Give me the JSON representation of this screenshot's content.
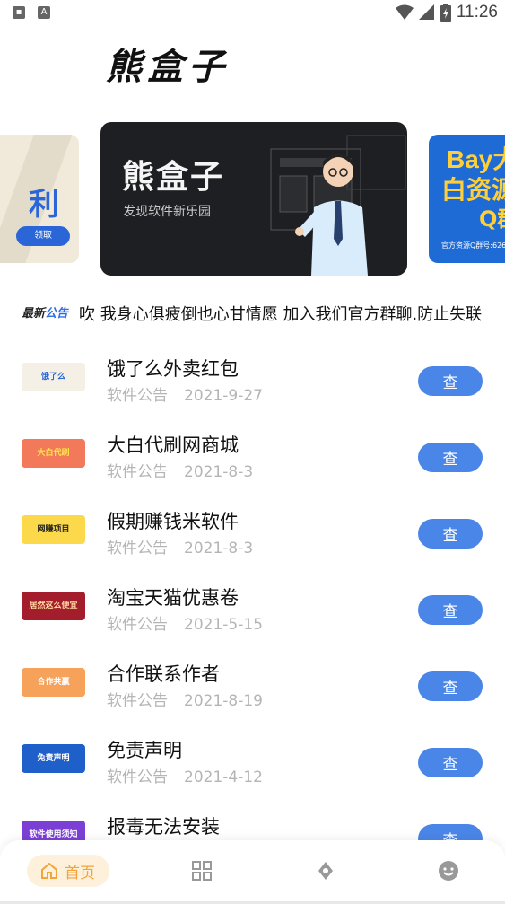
{
  "status_bar": {
    "time": "11:26"
  },
  "app": {
    "logo_text": "熊盒子"
  },
  "banners": [
    {
      "text": "利",
      "pill": "领取"
    },
    {
      "title": "熊盒子",
      "subtitle": "发现软件新乐园"
    },
    {
      "line1": "Bay大",
      "line2": "白资源",
      "line3": "Q群",
      "footer": "官方资源Q群号:626"
    }
  ],
  "announcement": {
    "tag_part1": "最新",
    "tag_part2": "公告",
    "text": "吹 我身心俱疲倒也心甘情愿 加入我们官方群聊.防止失联"
  },
  "list": {
    "action_label": "查",
    "category": "软件公告",
    "items": [
      {
        "title": "饿了么外卖红包",
        "date": "2021-9-27",
        "thumb_text": "饿了么",
        "thumb_bg": "#f4f0e6",
        "thumb_fg": "#2a66d8"
      },
      {
        "title": "大白代刷网商城",
        "date": "2021-8-3",
        "thumb_text": "大白代刷",
        "thumb_bg": "#f27a5b",
        "thumb_fg": "#ffe34d"
      },
      {
        "title": "假期赚钱米软件",
        "date": "2021-8-3",
        "thumb_text": "网赚项目",
        "thumb_bg": "#fbd94a",
        "thumb_fg": "#222"
      },
      {
        "title": "淘宝天猫优惠卷",
        "date": "2021-5-15",
        "thumb_text": "居然这么便宜",
        "thumb_bg": "#a41d2c",
        "thumb_fg": "#ffd9a0"
      },
      {
        "title": "合作联系作者",
        "date": "2021-8-19",
        "thumb_text": "合作共赢",
        "thumb_bg": "#f6a25a",
        "thumb_fg": "#fff"
      },
      {
        "title": "免责声明",
        "date": "2021-4-12",
        "thumb_text": "免责声明",
        "thumb_bg": "#1f5fc9",
        "thumb_fg": "#fff"
      },
      {
        "title": "报毒无法安装",
        "date": "",
        "thumb_text": "软件使用须知",
        "thumb_bg": "#7b3fd6",
        "thumb_fg": "#fff"
      }
    ]
  },
  "bottom_nav": {
    "home_label": "首页"
  },
  "colors": {
    "accent_blue": "#4a86e8",
    "home_orange": "#f2a33b",
    "meta_gray": "#b5b5b5"
  }
}
